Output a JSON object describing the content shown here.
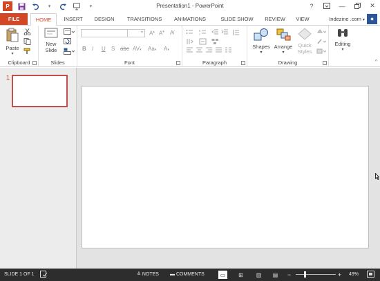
{
  "window": {
    "title": "Presentation1 - PowerPoint",
    "minimize_icon": "minimize-icon",
    "restore_icon": "restore-icon",
    "close_icon": "close-icon",
    "help_label": "?"
  },
  "qat": {
    "app_logo": "P",
    "save_icon": "save-icon",
    "undo_icon": "undo-icon",
    "redo_icon": "redo-icon",
    "start_icon": "slideshow-from-beginning-icon",
    "customize_icon": "customize-qat-icon"
  },
  "tabs": {
    "file": "FILE",
    "home": "HOME",
    "insert": "INSERT",
    "design": "DESIGN",
    "transitions": "TRANSITIONS",
    "animations": "ANIMATIONS",
    "slide_show": "SLIDE SHOW",
    "review": "REVIEW",
    "view": "VIEW",
    "user": "Indezine .com"
  },
  "ribbon": {
    "clipboard": {
      "label": "Clipboard",
      "paste": "Paste"
    },
    "slides": {
      "label": "Slides",
      "new_slide_line1": "New",
      "new_slide_line2": "Slide"
    },
    "font": {
      "label": "Font",
      "font_name": "",
      "font_size": ""
    },
    "paragraph": {
      "label": "Paragraph"
    },
    "drawing": {
      "label": "Drawing",
      "shapes": "Shapes",
      "arrange": "Arrange",
      "quick_styles_line1": "Quick",
      "quick_styles_line2": "Styles"
    },
    "editing": {
      "label": "Editing"
    }
  },
  "thumbnails": [
    {
      "number": "1"
    }
  ],
  "status": {
    "slide_info": "SLIDE 1 OF 1",
    "notes": "NOTES",
    "comments": "COMMENTS",
    "zoom": "49%",
    "zoom_level": 0.49
  },
  "colors": {
    "accent": "#d24726",
    "statusbar": "#2d2d2d",
    "workspace": "#e3e3e3"
  }
}
